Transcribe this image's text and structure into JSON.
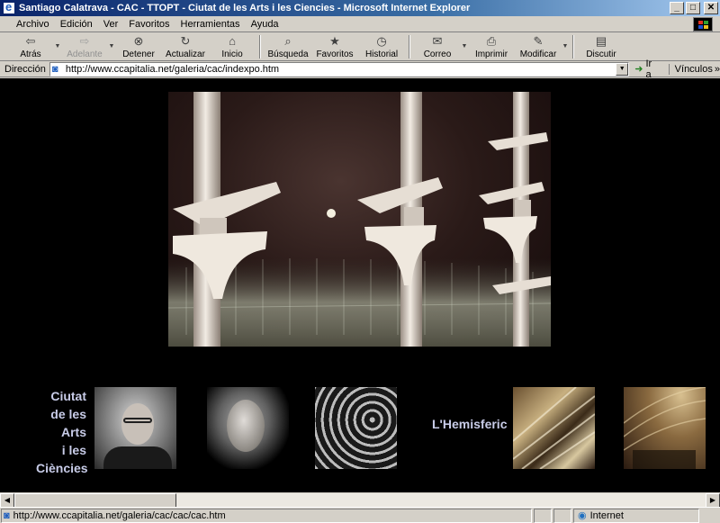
{
  "window": {
    "title": "Santiago Calatrava - CAC - TTOPT - Ciutat de les Arts i les Ciencies - Microsoft Internet Explorer",
    "buttons": {
      "minimize": "_",
      "maximize": "□",
      "close": "✕"
    }
  },
  "menu": [
    "Archivo",
    "Edición",
    "Ver",
    "Favoritos",
    "Herramientas",
    "Ayuda"
  ],
  "toolbar": {
    "buttons": [
      {
        "label": "Atrás",
        "icon": "back-arrow-icon",
        "glyph": "⇦",
        "disabled": false,
        "dropdown": true
      },
      {
        "label": "Adelante",
        "icon": "forward-arrow-icon",
        "glyph": "⇨",
        "disabled": true,
        "dropdown": true
      },
      {
        "label": "Detener",
        "icon": "stop-icon",
        "glyph": "⊗",
        "disabled": false,
        "dropdown": false
      },
      {
        "label": "Actualizar",
        "icon": "refresh-icon",
        "glyph": "↻",
        "disabled": false,
        "dropdown": false
      },
      {
        "label": "Inicio",
        "icon": "home-icon",
        "glyph": "⌂",
        "disabled": false,
        "dropdown": false
      },
      {
        "label": "Búsqueda",
        "icon": "search-icon",
        "glyph": "⌕",
        "disabled": false,
        "dropdown": false
      },
      {
        "label": "Favoritos",
        "icon": "favorites-icon",
        "glyph": "★",
        "disabled": false,
        "dropdown": false
      },
      {
        "label": "Historial",
        "icon": "history-icon",
        "glyph": "◷",
        "disabled": false,
        "dropdown": false
      },
      {
        "label": "Correo",
        "icon": "mail-icon",
        "glyph": "✉",
        "disabled": false,
        "dropdown": true
      },
      {
        "label": "Imprimir",
        "icon": "print-icon",
        "glyph": "⎙",
        "disabled": false,
        "dropdown": false
      },
      {
        "label": "Modificar",
        "icon": "edit-icon",
        "glyph": "✎",
        "disabled": false,
        "dropdown": true
      },
      {
        "label": "Discutir",
        "icon": "discuss-icon",
        "glyph": "▤",
        "disabled": false,
        "dropdown": false
      }
    ]
  },
  "address": {
    "label": "Dirección",
    "url": "http://www.ccapitalia.net/galeria/cac/indexpo.htm",
    "go_label": "Ir a",
    "links_label": "Vínculos"
  },
  "page": {
    "side_title": [
      "Ciutat",
      "de les",
      "Arts",
      "i les",
      "Ciències"
    ],
    "hemisferic_label": "L'Hemisferic"
  },
  "status": {
    "text": "http://www.ccapitalia.net/galeria/cac/cac/cac.htm",
    "zone": "Internet"
  }
}
